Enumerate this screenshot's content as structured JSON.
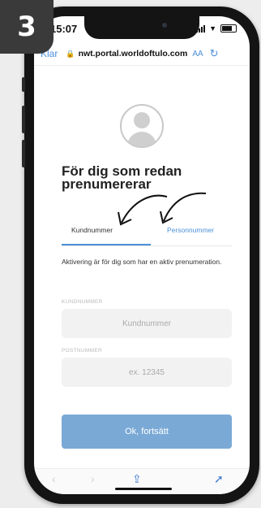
{
  "step": {
    "number": "3"
  },
  "status_bar": {
    "time": "15:07"
  },
  "browser": {
    "done_label": "Klar",
    "url": "nwt.portal.worldoftulo.com",
    "text_size": "AA"
  },
  "login": {
    "heading": "För dig som redan prenumererar",
    "tabs": [
      {
        "label": "Kundnummer",
        "active": true
      },
      {
        "label": "Personnummer",
        "active": false
      }
    ],
    "info_text": "Aktivering är för dig som har en aktiv prenumeration.",
    "customer_number": {
      "label": "KUNDNUMMER",
      "placeholder": "Kundnummer"
    },
    "postal_code": {
      "label": "POSTNUMMER",
      "placeholder": "ex. 12345"
    },
    "submit_label": "Ok, fortsätt"
  },
  "colors": {
    "accent": "#4a90d9",
    "button": "#7aa9d6",
    "badge": "#3a3a3a"
  },
  "icons": [
    "lock-icon",
    "reload-icon",
    "back-icon",
    "forward-icon",
    "share-icon",
    "compass-icon"
  ]
}
